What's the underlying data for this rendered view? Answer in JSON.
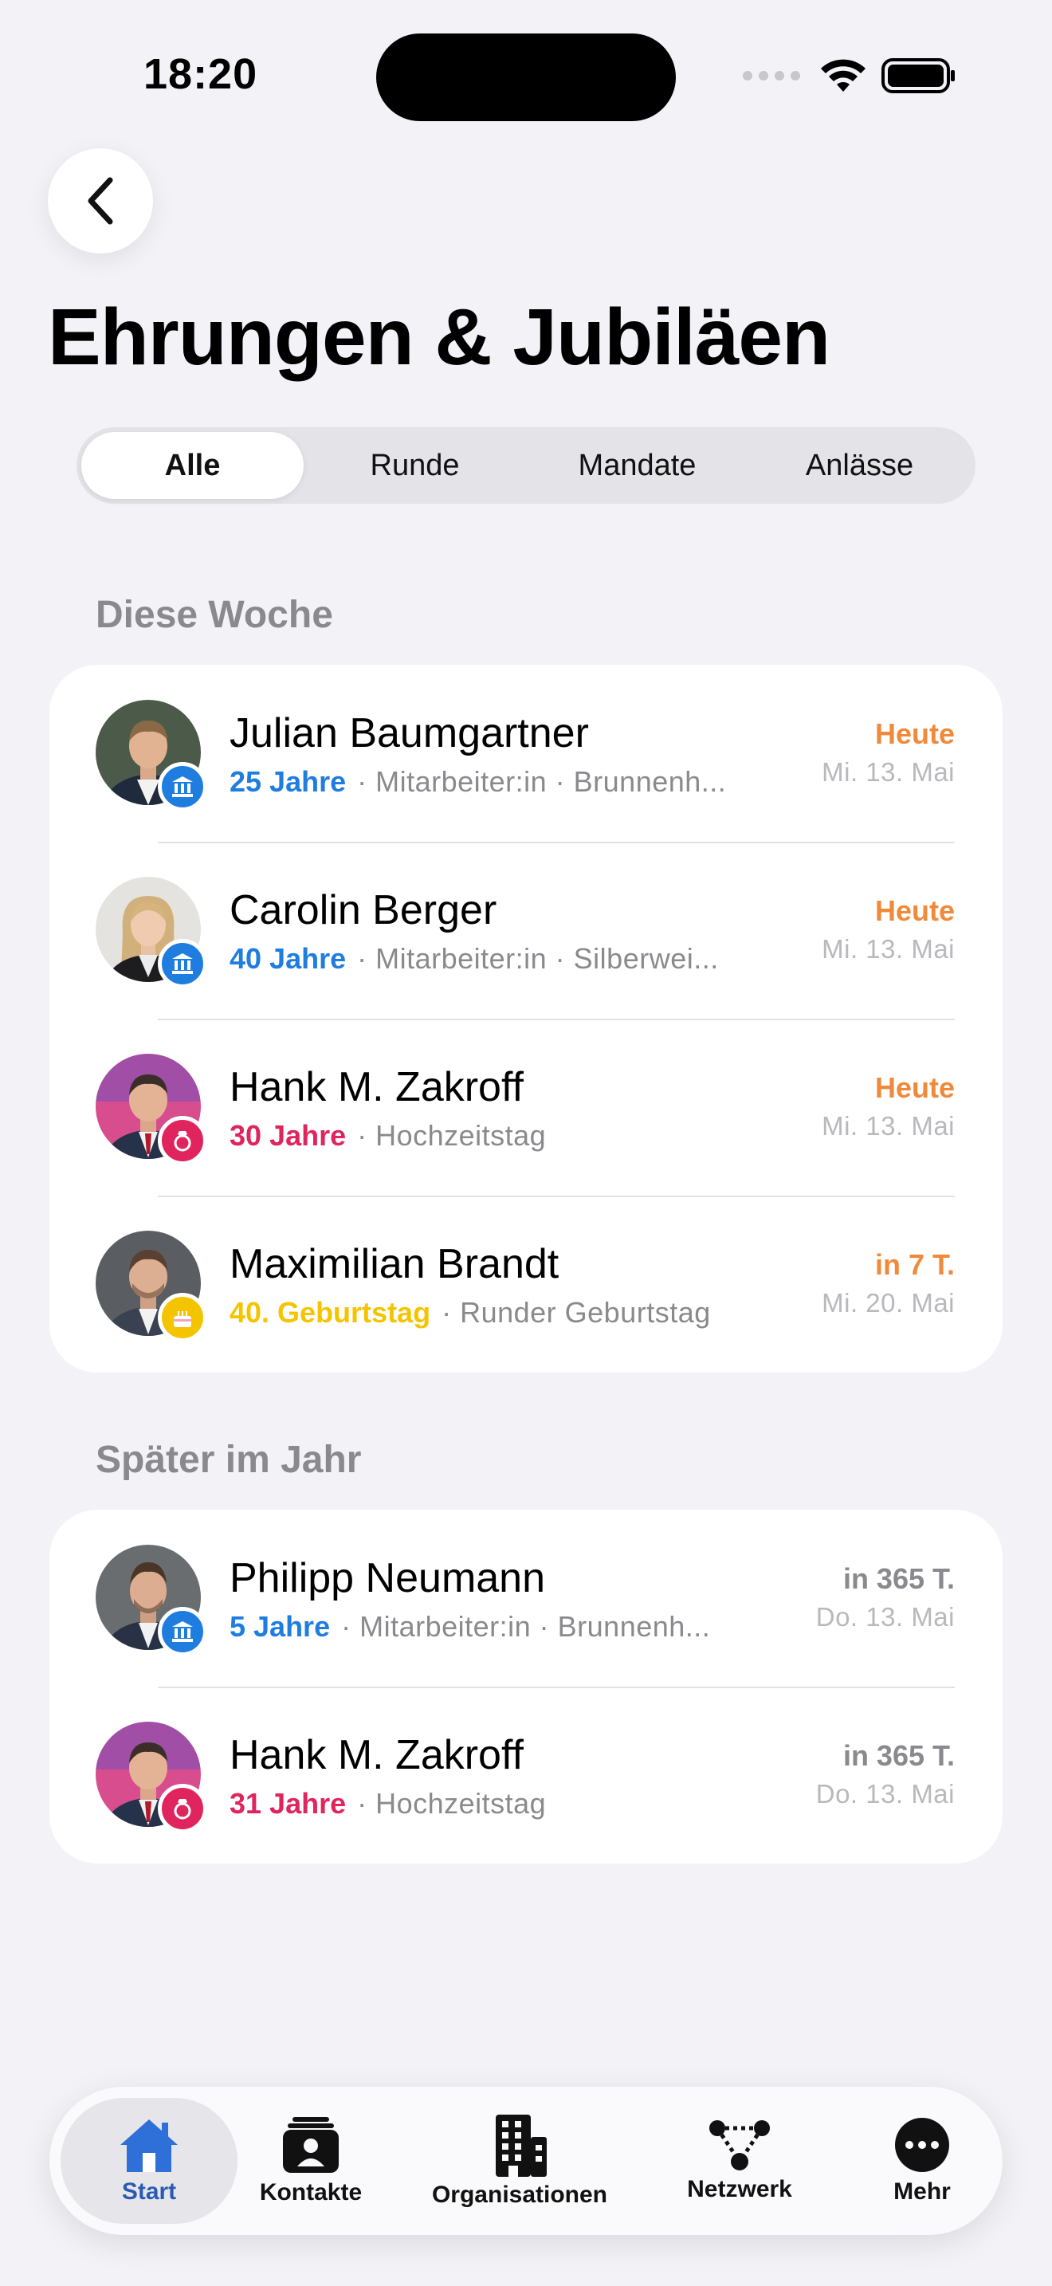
{
  "status": {
    "time": "18:20"
  },
  "title": "Ehrungen & Jubiläen",
  "segments": [
    "Alle",
    "Runde",
    "Mandate",
    "Anlässe"
  ],
  "active_segment": "Alle",
  "sections": [
    {
      "title": "Diese Woche",
      "items": [
        {
          "name": "Julian Baumgartner",
          "tag": "25 Jahre",
          "tag_color": "#1f7de0",
          "meta": "· Mitarbeiter:in · Brunnenh...",
          "when": "Heute",
          "when_color": "#f08a3a",
          "date": "Mi. 13. Mai",
          "badge": "institution-icon"
        },
        {
          "name": "Carolin Berger",
          "tag": "40 Jahre",
          "tag_color": "#1f7de0",
          "meta": "· Mitarbeiter:in · Silberwei...",
          "when": "Heute",
          "when_color": "#f08a3a",
          "date": "Mi. 13. Mai",
          "badge": "institution-icon"
        },
        {
          "name": "Hank M. Zakroff",
          "tag": "30 Jahre",
          "tag_color": "#e0245e",
          "meta": "· Hochzeitstag",
          "when": "Heute",
          "when_color": "#f08a3a",
          "date": "Mi. 13. Mai",
          "badge": "ring-icon"
        },
        {
          "name": "Maximilian Brandt",
          "tag": "40. Geburtstag",
          "tag_color": "#f5c400",
          "meta": "· Runder Geburtstag",
          "when": "in 7 T.",
          "when_color": "#f08a3a",
          "date": "Mi. 20. Mai",
          "badge": "cake-icon"
        }
      ]
    },
    {
      "title": "Später im Jahr",
      "items": [
        {
          "name": "Philipp Neumann",
          "tag": "5 Jahre",
          "tag_color": "#1f7de0",
          "meta": "· Mitarbeiter:in · Brunnenh...",
          "when": "in 365 T.",
          "when_color": "#8a8a8e",
          "date": "Do. 13. Mai",
          "badge": "institution-icon"
        },
        {
          "name": "Hank M. Zakroff",
          "tag": "31 Jahre",
          "tag_color": "#e0245e",
          "meta": "· Hochzeitstag",
          "when": "in 365 T.",
          "when_color": "#8a8a8e",
          "date": "Do. 13. Mai",
          "badge": "ring-icon"
        }
      ]
    }
  ],
  "tabs": [
    {
      "label": "Start",
      "icon": "house-icon"
    },
    {
      "label": "Kontakte",
      "icon": "contacts-icon"
    },
    {
      "label": "Organisationen",
      "icon": "building-icon"
    },
    {
      "label": "Netzwerk",
      "icon": "network-icon"
    },
    {
      "label": "Mehr",
      "icon": "more-icon"
    }
  ],
  "active_tab": "Start",
  "colors": {
    "accent": "#2a5bb3",
    "background": "#f2f2f7"
  }
}
